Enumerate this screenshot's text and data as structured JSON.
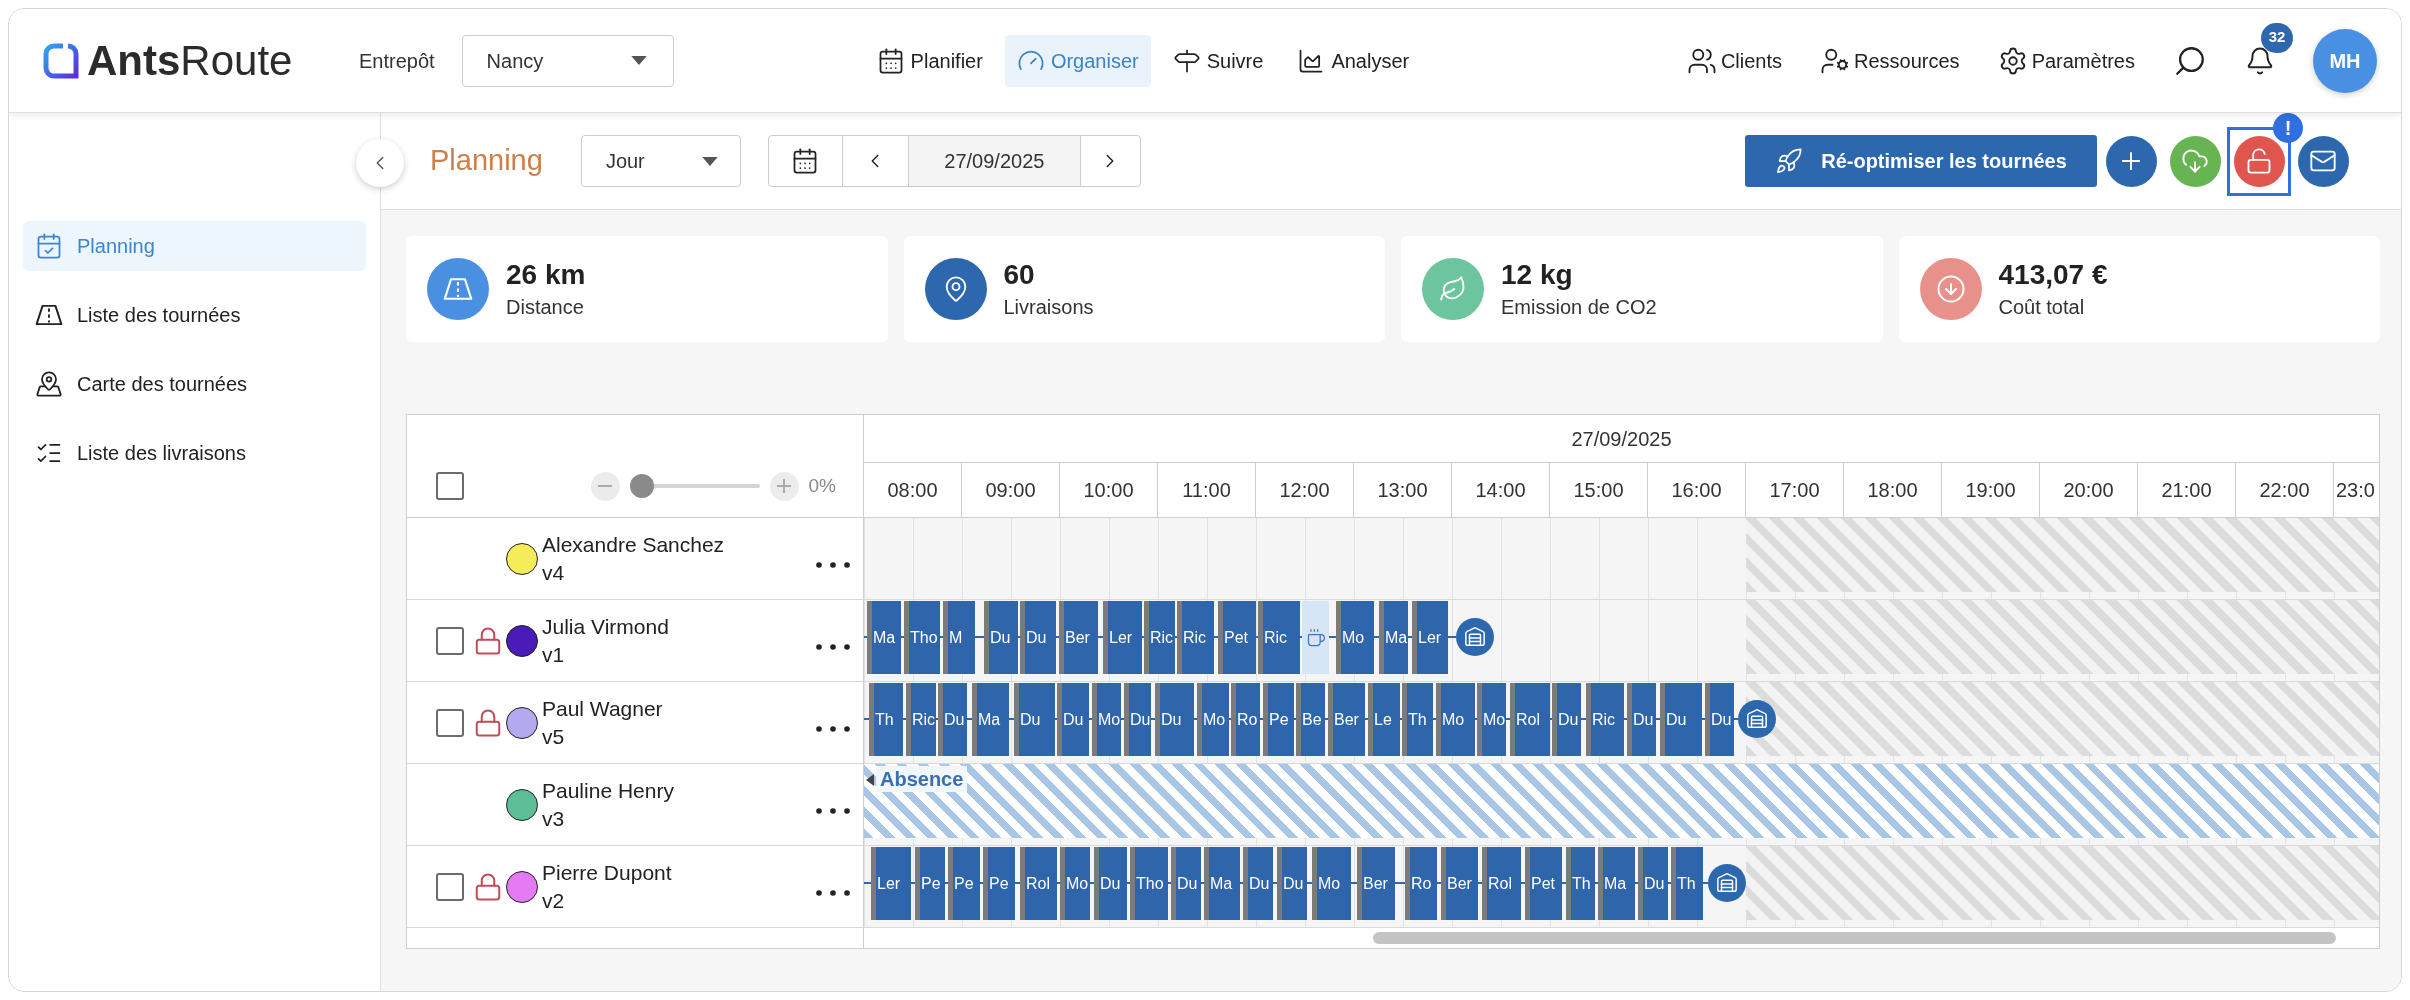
{
  "header": {
    "logo": "**Ants**Route",
    "warehouse": {
      "label": "Entrepôt",
      "value": "Nancy"
    },
    "nav": [
      {
        "label": "Planifier",
        "selected": false
      },
      {
        "label": "Organiser",
        "selected": true
      },
      {
        "label": "Suivre",
        "selected": false
      },
      {
        "label": "Analyser",
        "selected": false
      }
    ],
    "links": [
      {
        "label": "Clients"
      },
      {
        "label": "Ressources"
      },
      {
        "label": "Paramètres"
      }
    ],
    "notifications": {
      "count": "32"
    },
    "avatar": {
      "initials": "MH"
    }
  },
  "sidebar": {
    "items": [
      {
        "label": "Planning",
        "selected": true
      },
      {
        "label": "Liste des tournées",
        "selected": false
      },
      {
        "label": "Carte des tournées",
        "selected": false
      },
      {
        "label": "Liste des livraisons",
        "selected": false
      }
    ]
  },
  "toolbar": {
    "title": "Planning",
    "view": {
      "value": "Jour"
    },
    "date": "27/09/2025",
    "primary_button": "Ré-optimiser les tournées",
    "actions": [
      {
        "kind": "add"
      },
      {
        "kind": "download"
      },
      {
        "kind": "unlock",
        "highlighted": true,
        "badge": "!"
      },
      {
        "kind": "mail"
      }
    ]
  },
  "kpis": [
    {
      "kind": "distance",
      "value": "26 km",
      "label": "Distance"
    },
    {
      "kind": "deliveries",
      "value": "60",
      "label": "Livraisons"
    },
    {
      "kind": "co2",
      "value": "12 kg",
      "label": "Emission de CO2"
    },
    {
      "kind": "cost",
      "value": "413,07 €",
      "label": "Coût total"
    }
  ],
  "gantt": {
    "select_all": {
      "checked": false
    },
    "zoom": {
      "level": 0,
      "reading": "0%"
    },
    "date": "27/09/2025",
    "hours": [
      "08:00",
      "09:00",
      "10:00",
      "11:00",
      "12:00",
      "13:00",
      "14:00",
      "15:00",
      "16:00",
      "17:00",
      "18:00",
      "19:00",
      "20:00",
      "21:00",
      "22:00",
      "23:0"
    ],
    "rows": [
      {
        "kind": "idle",
        "name": "Alexandre Sanchez",
        "vehicle": "v4",
        "color": "#f5ec5a",
        "off_hours": true
      },
      {
        "kind": "route",
        "name": "Julia Virmond",
        "vehicle": "v1",
        "color": "#4a1bb6",
        "checked": false,
        "locked": true,
        "off_hours": true,
        "tasks": [
          {
            "kind": "stop",
            "label": "Ma"
          },
          {
            "kind": "stop",
            "label": "Tho"
          },
          {
            "kind": "stop",
            "label": "M"
          },
          {
            "kind": "stop",
            "label": "Du"
          },
          {
            "kind": "stop",
            "label": "Du"
          },
          {
            "kind": "stop",
            "label": "Ber"
          },
          {
            "kind": "stop",
            "label": "Ler"
          },
          {
            "kind": "stop",
            "label": "Ric"
          },
          {
            "kind": "stop",
            "label": "Ric"
          },
          {
            "kind": "stop",
            "label": "Pet"
          },
          {
            "kind": "stop",
            "label": "Ric"
          },
          {
            "kind": "break"
          },
          {
            "kind": "stop",
            "label": "Mo"
          },
          {
            "kind": "stop",
            "label": "Ma"
          },
          {
            "kind": "stop",
            "label": "Ler"
          },
          {
            "kind": "depot"
          }
        ]
      },
      {
        "kind": "route",
        "name": "Paul Wagner",
        "vehicle": "v5",
        "color": "#b3a9ef",
        "checked": false,
        "locked": true,
        "off_hours": true,
        "tasks": [
          {
            "kind": "stop",
            "label": "Th"
          },
          {
            "kind": "stop",
            "label": "Ric"
          },
          {
            "kind": "stop",
            "label": "Du"
          },
          {
            "kind": "stop",
            "label": "Ma"
          },
          {
            "kind": "stop",
            "label": "Du"
          },
          {
            "kind": "stop",
            "label": "Du"
          },
          {
            "kind": "stop",
            "label": "Mo"
          },
          {
            "kind": "stop",
            "label": "Du"
          },
          {
            "kind": "stop",
            "label": "Du"
          },
          {
            "kind": "stop",
            "label": "Mo"
          },
          {
            "kind": "stop",
            "label": "Ro"
          },
          {
            "kind": "stop",
            "label": "Pe"
          },
          {
            "kind": "stop",
            "label": "Be"
          },
          {
            "kind": "stop",
            "label": "Ber"
          },
          {
            "kind": "stop",
            "label": "Le"
          },
          {
            "kind": "stop",
            "label": "Th"
          },
          {
            "kind": "stop",
            "label": "Mo"
          },
          {
            "kind": "stop",
            "label": "Mo"
          },
          {
            "kind": "stop",
            "label": "Rol"
          },
          {
            "kind": "stop",
            "label": "Du"
          },
          {
            "kind": "stop",
            "label": "Ric"
          },
          {
            "kind": "stop",
            "label": "Du"
          },
          {
            "kind": "stop",
            "label": "Du"
          },
          {
            "kind": "stop",
            "label": "Du"
          },
          {
            "kind": "depot"
          }
        ]
      },
      {
        "kind": "absence",
        "name": "Pauline Henry",
        "vehicle": "v3",
        "color": "#5cbf97",
        "absence": "Absence"
      },
      {
        "kind": "route",
        "name": "Pierre Dupont",
        "vehicle": "v2",
        "color": "#e27bf4",
        "checked": false,
        "locked": true,
        "off_hours": true,
        "tasks": [
          {
            "kind": "stop",
            "label": "Ler"
          },
          {
            "kind": "stop",
            "label": "Pe"
          },
          {
            "kind": "stop",
            "label": "Pe"
          },
          {
            "kind": "stop",
            "label": "Pe"
          },
          {
            "kind": "stop",
            "label": "Rol"
          },
          {
            "kind": "stop",
            "label": "Mo"
          },
          {
            "kind": "stop",
            "label": "Du"
          },
          {
            "kind": "stop",
            "label": "Tho"
          },
          {
            "kind": "stop",
            "label": "Du"
          },
          {
            "kind": "stop",
            "label": "Ma"
          },
          {
            "kind": "stop",
            "label": "Du"
          },
          {
            "kind": "stop",
            "label": "Du"
          },
          {
            "kind": "stop",
            "label": "Mo"
          },
          {
            "kind": "stop",
            "label": "Ber"
          },
          {
            "kind": "stop",
            "label": "Ro"
          },
          {
            "kind": "stop",
            "label": "Ber"
          },
          {
            "kind": "stop",
            "label": "Rol"
          },
          {
            "kind": "stop",
            "label": "Pet"
          },
          {
            "kind": "stop",
            "label": "Th"
          },
          {
            "kind": "stop",
            "label": "Ma"
          },
          {
            "kind": "stop",
            "label": "Du"
          },
          {
            "kind": "stop",
            "label": "Th"
          },
          {
            "kind": "depot"
          }
        ]
      }
    ]
  }
}
